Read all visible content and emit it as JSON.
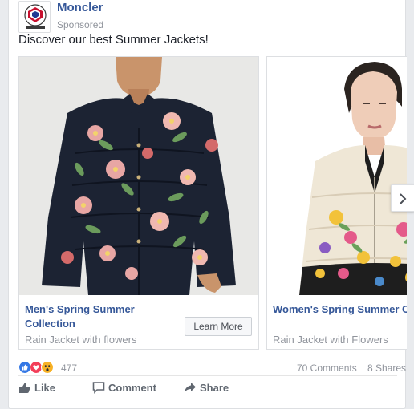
{
  "post": {
    "page_name": "Moncler",
    "sponsored_label": "Sponsored",
    "avatar_text": "MONCLER",
    "text": "Discover our best Summer Jackets!"
  },
  "carousel": {
    "cards": [
      {
        "title": "Men's Spring Summer Collection",
        "subtitle": "Rain Jacket with flowers",
        "button": "Learn More",
        "image": "man-in-floral-puffer-jacket"
      },
      {
        "title": "Women's Spring Summer C",
        "subtitle": "Rain Jacket with Flowers",
        "image": "woman-in-floral-puffer-jacket"
      }
    ],
    "next_icon": "chevron-right-icon"
  },
  "stats": {
    "reaction_icons": [
      "like-icon",
      "love-icon",
      "wow-icon"
    ],
    "reaction_count": "477",
    "comments": "70 Comments",
    "shares": "8 Shares"
  },
  "actions": {
    "like": "Like",
    "comment": "Comment",
    "share": "Share"
  },
  "colors": {
    "link": "#365899",
    "muted": "#90949c",
    "like_blue": "#3578e5",
    "love_red": "#f33e58",
    "wow_yellow": "#f7b125"
  }
}
